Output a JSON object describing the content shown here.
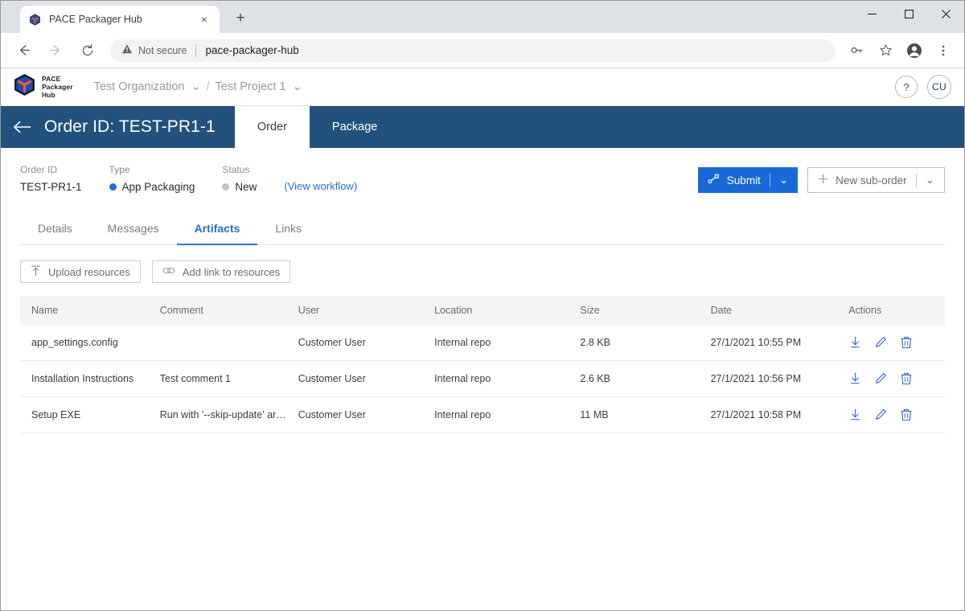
{
  "browser": {
    "tab": {
      "title": "PACE Packager Hub",
      "favicon": "pace-cube-icon",
      "close": "×"
    },
    "new_tab": "+",
    "window_controls": {
      "minimize": "−",
      "maximize": "□",
      "close": "✕"
    },
    "nav": {
      "back": "←",
      "forward": "→",
      "reload": "⟳"
    },
    "omnibox": {
      "security_label": "Not secure",
      "url": "pace-packager-hub"
    },
    "toolbar_icons": [
      "key-icon",
      "star-icon",
      "profile-icon",
      "kebab-menu-icon"
    ]
  },
  "app_header": {
    "logo_lines": [
      "PACE",
      "Packager",
      "Hub"
    ],
    "breadcrumb": [
      {
        "label": "Test Organization",
        "caret": "⌄"
      },
      {
        "label": "Test Project 1",
        "caret": "⌄"
      }
    ],
    "separator": "/",
    "help_label": "?",
    "avatar_initials": "CU"
  },
  "title_bar": {
    "back": "←",
    "title": "Order ID: TEST-PR1-1",
    "tabs": [
      {
        "label": "Order",
        "active": true
      },
      {
        "label": "Package",
        "active": false
      }
    ],
    "bg_color": "#22517d"
  },
  "meta": {
    "fields": [
      {
        "label": "Order ID",
        "value": "TEST-PR1-1",
        "dot_color": null
      },
      {
        "label": "Type",
        "value": "App Packaging",
        "dot_color": "#1f6fe0"
      },
      {
        "label": "Status",
        "value": "New",
        "dot_color": "#c4c4c4"
      }
    ],
    "workflow_link": "(View workflow)",
    "submit_button": {
      "label": "Submit",
      "icon": "workflow-branch-icon",
      "caret": "⌄",
      "color": "#1868d8"
    },
    "new_suborder_button": {
      "label": "New sub-order",
      "icon": "plus-icon",
      "caret": "⌄"
    }
  },
  "subtabs": [
    {
      "label": "Details",
      "active": false
    },
    {
      "label": "Messages",
      "active": false
    },
    {
      "label": "Artifacts",
      "active": true
    },
    {
      "label": "Links",
      "active": false
    }
  ],
  "resource_toolbar": [
    {
      "label": "Upload resources",
      "icon": "upload-icon"
    },
    {
      "label": "Add link to resources",
      "icon": "link-icon"
    }
  ],
  "table": {
    "columns": [
      "Name",
      "Comment",
      "User",
      "Location",
      "Size",
      "Date",
      "Actions"
    ],
    "rows": [
      {
        "name": "app_settings.config",
        "comment": "",
        "user": "Customer User",
        "location": "Internal repo",
        "size": "2.8 KB",
        "date": "27/1/2021 10:55 PM"
      },
      {
        "name": "Installation Instructions",
        "comment": "Test comment 1",
        "user": "Customer User",
        "location": "Internal repo",
        "size": "2.6 KB",
        "date": "27/1/2021 10:56 PM"
      },
      {
        "name": "Setup EXE",
        "comment": "Run with '--skip-update' argu...",
        "user": "Customer User",
        "location": "Internal repo",
        "size": "11 MB",
        "date": "27/1/2021 10:58 PM"
      }
    ],
    "row_action_icons": [
      "download-icon",
      "edit-pencil-icon",
      "delete-trash-icon"
    ],
    "action_color": "#3761c9"
  }
}
